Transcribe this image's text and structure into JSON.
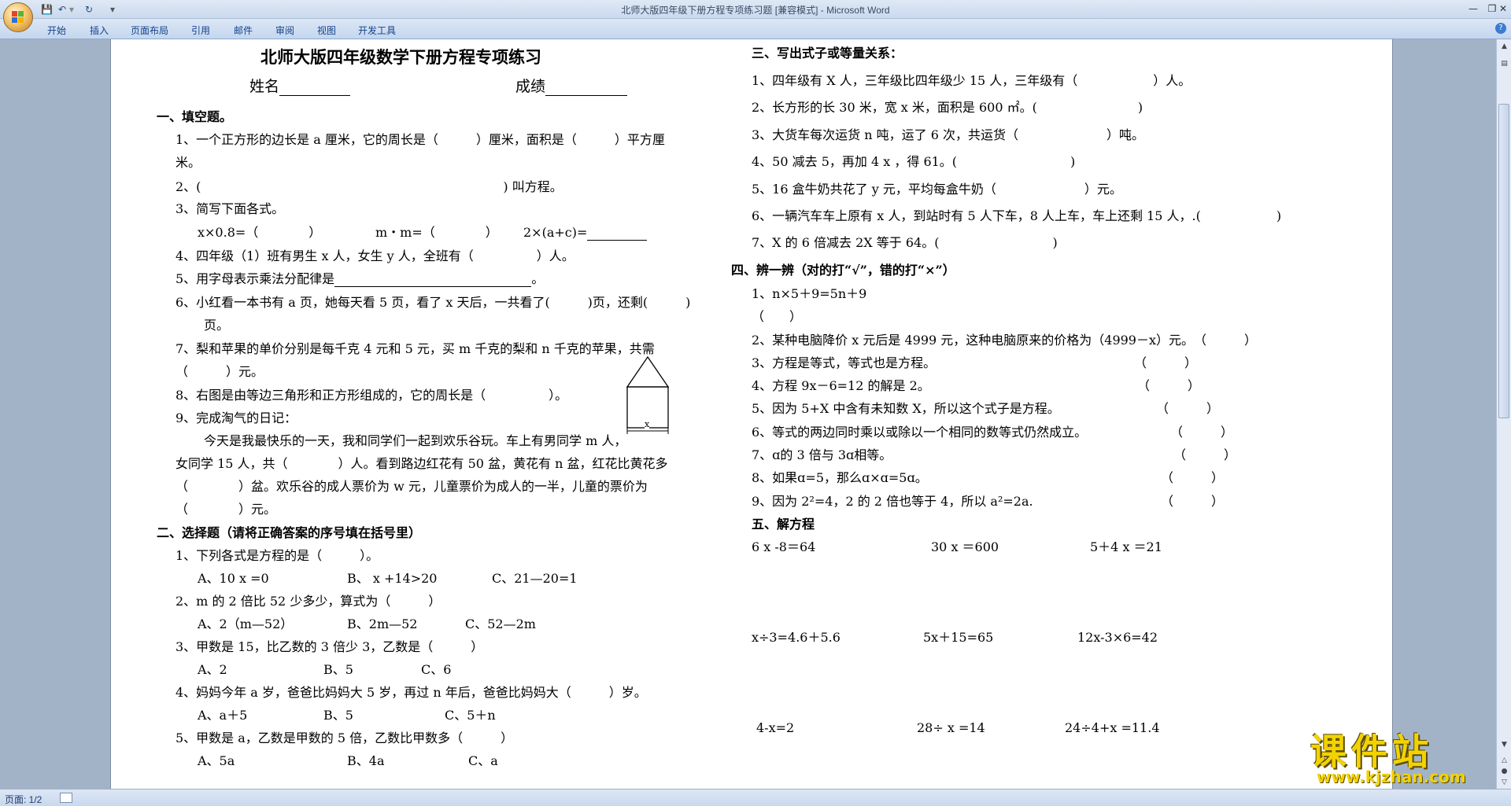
{
  "window": {
    "title": "北师大版四年级下册方程专项练习题 [兼容模式] - Microsoft Word"
  },
  "ribbon": {
    "tabs": [
      "开始",
      "插入",
      "页面布局",
      "引用",
      "邮件",
      "审阅",
      "视图",
      "开发工具"
    ]
  },
  "status": {
    "page": "页面: 1/2"
  },
  "watermark": {
    "text": "课件站",
    "url": "www.kjzhan.com"
  },
  "doc": {
    "title": "北师大版四年级数学下册方程专项练习",
    "name_label": "姓名",
    "score_label": "成绩",
    "s1": {
      "heading": "一、填空题。",
      "q1a": "1、一个正方形的边长是 a 厘米，它的周长是（　　　）厘米，面积是（　　　）平方厘",
      "q1b": "米。",
      "q2": "2、(　　　　　　　　　　　　　　　　　　　　　　　　) 叫方程。",
      "q3": "3、简写下面各式。",
      "q3a": "x×0.8=（　　　　）",
      "q3b": "m・m=（　　　　）",
      "q3c": "2×(a+c)=",
      "q4": "4、四年级（1）班有男生 x 人，女生 y 人，全班有（　　　　　）人。",
      "q5": "5、用字母表示乘法分配律是",
      "q5end": "。",
      "q6a": "6、小红看一本书有 a 页，她每天看 5 页，看了 x 天后，一共看了(　　　)页，还剩(　　　)",
      "q6b": "页。",
      "q7a": "7、梨和苹果的单价分别是每千克 4 元和 5 元，买 m 千克的梨和 n 千克的苹果，共需",
      "q7b": "（　　　）元。",
      "q8": "8、右图是由等边三角形和正方形组成的，它的周长是（　　　　　）。",
      "fig_label": "x",
      "q9": "9、完成淘气的日记：",
      "q9a": "今天是我最快乐的一天，我和同学们一起到欢乐谷玩。车上有男同学 m 人，",
      "q9b": "女同学 15 人，共（　　　　）人。看到路边红花有 50 盆，黄花有 n 盆，红花比黄花多",
      "q9c": "（　　　　）盆。欢乐谷的成人票价为 w 元，儿童票价为成人的一半，儿童的票价为",
      "q9d": "（　　　　）元。"
    },
    "s2": {
      "heading": "二、选择题（请将正确答案的序号填在括号里）",
      "q1": "1、下列各式是方程的是（　　　）。",
      "q1o": [
        "A、10 x =0",
        "B、 x +14>20",
        "C、21—20=1"
      ],
      "q2": "2、m 的 2 倍比 52 少多少，算式为（　　　）",
      "q2o": [
        "A、2（m—52）",
        "B、2m—52",
        "C、52—2m"
      ],
      "q3": "3、甲数是 15，比乙数的 3 倍少 3，乙数是（　　　）",
      "q3o": [
        "A、2",
        "B、5",
        "C、6"
      ],
      "q4": "4、妈妈今年 a 岁，爸爸比妈妈大 5 岁，再过 n 年后，爸爸比妈妈大（　　　）岁。",
      "q4o": [
        "A、a＋5",
        "B、5",
        "C、5＋n"
      ],
      "q5": "5、甲数是 a，乙数是甲数的 5 倍，乙数比甲数多（　　　）",
      "q5o": [
        "A、5a",
        "B、4a",
        "C、a"
      ]
    },
    "s3": {
      "heading": "三、写出式子或等量关系：",
      "q1": "1、四年级有 X 人，三年级比四年级少 15 人，三年级有（　　　　　　）人。",
      "q2": "2、长方形的长 30 米，宽 x 米，面积是 600 ㎡。(　　　　　　　　)",
      "q3": "3、大货车每次运货 n 吨，运了 6 次，共运货（　　　　　　　）吨。",
      "q4": "4、50 减去 5，再加 4 x ，得 61。(　　　　　　　　　)",
      "q5": "5、16 盒牛奶共花了 y 元，平均每盒牛奶（　　　　　　　）元。",
      "q6": "6、一辆汽车车上原有 x 人，到站时有 5 人下车，8 人上车，车上还剩 15 人，.(　　　　　　)",
      "q7": "7、X 的 6 倍减去 2X 等于 64。(　　　　　　　　　)"
    },
    "s4": {
      "heading": "四、辨一辨（对的打“√”，错的打“×”）",
      "q1": "1、n×5＋9=5n＋9",
      "q1b": "（　　）",
      "q2": "2、某种电脑降价 x 元后是 4999 元，这种电脑原来的价格为（4999－x）元。　（　　　）",
      "q3": "3、方程是等式，等式也是方程。",
      "q4": "4、方程 9x－6=12 的解是 2。",
      "q5": "5、因为 5+X 中含有未知数 X，所以这个式子是方程。",
      "q6": "6、等式的两边同时乘以或除以一个相同的数等式仍然成立。",
      "q7": "7、ɑ的 3 倍与 3ɑ相等。",
      "q8": "8、如果ɑ=5，那么ɑ×ɑ=5ɑ。",
      "q9": "9、因为 2²=4，2 的 2 倍也等于 4，所以 a²=2a.",
      "bracket": "（　　　）"
    },
    "s5": {
      "heading": "五、解方程",
      "eqs": [
        "6 x -8＝64",
        "30 x ＝600",
        "5＋4 x ＝21",
        "x÷3=4.6＋5.6",
        "5x＋15=65",
        "12x-3×6=42",
        "4-x=2",
        "28÷ x =14",
        "24÷4+x =11.4"
      ]
    }
  }
}
